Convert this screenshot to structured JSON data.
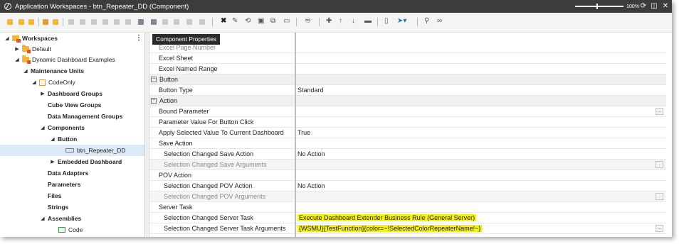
{
  "window": {
    "title": "Application Workspaces - btn_Repeater_DD (Component)",
    "zoom": "100%"
  },
  "tooltip": "Component Properties",
  "tree": {
    "items": [
      {
        "label": "Workspaces"
      },
      {
        "label": "Default"
      },
      {
        "label": "Dynamic Dashboard Examples"
      },
      {
        "label": "Maintenance Units"
      },
      {
        "label": "CodeOnly"
      },
      {
        "label": "Dashboard Groups"
      },
      {
        "label": "Cube View Groups"
      },
      {
        "label": "Data Management Groups"
      },
      {
        "label": "Components"
      },
      {
        "label": "Button"
      },
      {
        "label": "btn_Repeater_DD"
      },
      {
        "label": "Embedded Dashboard"
      },
      {
        "label": "Data Adapters"
      },
      {
        "label": "Parameters"
      },
      {
        "label": "Files"
      },
      {
        "label": "Strings"
      },
      {
        "label": "Assemblies"
      },
      {
        "label": "Code"
      }
    ]
  },
  "grid": {
    "rows": [
      {
        "name": "Excel Page Number",
        "value": ""
      },
      {
        "name": "Excel Sheet",
        "value": ""
      },
      {
        "name": "Excel Named Range",
        "value": ""
      },
      {
        "name": "Button",
        "value": ""
      },
      {
        "name": "Button Type",
        "value": "Standard"
      },
      {
        "name": "Action",
        "value": ""
      },
      {
        "name": "Bound Parameter",
        "value": "",
        "button": "..."
      },
      {
        "name": "Parameter Value For Button Click",
        "value": ""
      },
      {
        "name": "Apply Selected Value To Current Dashboard",
        "value": "True"
      },
      {
        "name": "Save Action",
        "value": ""
      },
      {
        "name": "Selection Changed Save Action",
        "value": "No Action"
      },
      {
        "name": "Selection Changed Save Arguments",
        "value": "",
        "button": "..."
      },
      {
        "name": "POV Action",
        "value": ""
      },
      {
        "name": "Selection Changed POV Action",
        "value": "No Action"
      },
      {
        "name": "Selection Changed POV Arguments",
        "value": "",
        "button": "..."
      },
      {
        "name": "Server Task",
        "value": ""
      },
      {
        "name": "Selection Changed Server Task",
        "value": "Execute Dashboard Extender Business Rule (General Server)"
      },
      {
        "name": "Selection Changed Server Task Arguments",
        "value": "{WSMU}{TestFunction}{color=~!SelectedColorRepeaterName!~}",
        "button": "..."
      }
    ]
  },
  "colors": {
    "titlebar": "#3c3c3c",
    "highlight": "#f5f21a",
    "selected_row": "#dce9f7",
    "folder": "#f2b63b"
  }
}
